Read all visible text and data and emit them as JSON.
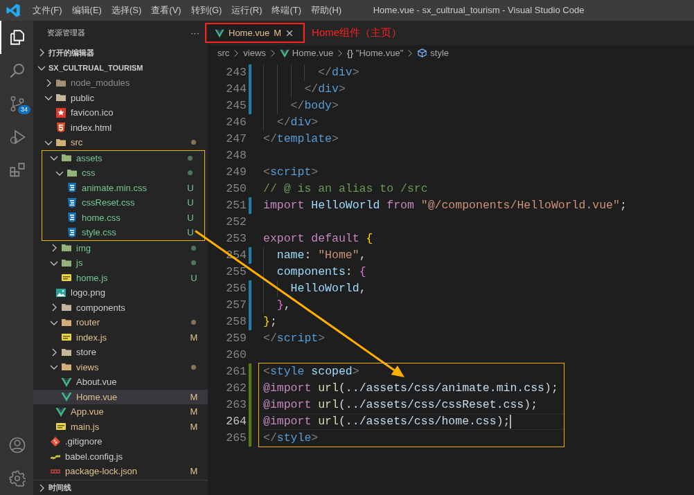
{
  "window": {
    "title": "Home.vue - sx_cultrual_tourism - Visual Studio Code"
  },
  "menu": [
    "文件(F)",
    "编辑(E)",
    "选择(S)",
    "查看(V)",
    "转到(G)",
    "运行(R)",
    "终端(T)",
    "帮助(H)"
  ],
  "activity_bar": [
    {
      "kind": "explorer",
      "selected": true
    },
    {
      "kind": "search",
      "selected": false
    },
    {
      "kind": "source-control",
      "selected": false,
      "badge": "34"
    },
    {
      "kind": "run",
      "selected": false
    },
    {
      "kind": "extensions",
      "selected": false
    }
  ],
  "activity_bar_bottom": [
    {
      "kind": "account",
      "selected": false
    },
    {
      "kind": "settings",
      "selected": false
    }
  ],
  "sidebar": {
    "title": "资源管理器",
    "more": "···",
    "open_editors": {
      "label": "打开的编辑器",
      "expanded": false
    },
    "project": {
      "label": "SX_CULTRUAL_TOURISM",
      "expanded": true
    },
    "tree": [
      {
        "name": "node_modules",
        "kind": "folder",
        "color": "#8c8c8c",
        "expanded": false,
        "selected": false
      },
      {
        "name": "public",
        "kind": "folder",
        "color": "#cccccc",
        "expanded": true,
        "selected": false,
        "children": [
          {
            "name": "favicon.ico",
            "kind": "star",
            "color": "#cccccc",
            "selected": false
          },
          {
            "name": "index.html",
            "kind": "html",
            "color": "#cccccc",
            "selected": false
          }
        ]
      },
      {
        "name": "src",
        "kind": "folder",
        "color": "#e2c08d",
        "expanded": true,
        "dot": true,
        "selected": false,
        "children": [
          {
            "name": "assets",
            "kind": "folder",
            "color": "#73c991",
            "expanded": true,
            "dot": true,
            "framed": true,
            "selected": false,
            "children": [
              {
                "name": "css",
                "kind": "folder",
                "color": "#73c991",
                "expanded": true,
                "dot": true,
                "selected": false,
                "children": [
                  {
                    "name": "animate.min.css",
                    "kind": "css",
                    "color": "#73c991",
                    "badge": "U",
                    "selected": false
                  },
                  {
                    "name": "cssReset.css",
                    "kind": "css",
                    "color": "#73c991",
                    "badge": "U",
                    "selected": false
                  },
                  {
                    "name": "home.css",
                    "kind": "css",
                    "color": "#73c991",
                    "badge": "U",
                    "selected": false
                  },
                  {
                    "name": "style.css",
                    "kind": "css",
                    "color": "#73c991",
                    "badge": "U",
                    "selected": false
                  }
                ]
              }
            ]
          },
          {
            "name": "img",
            "kind": "folder",
            "color": "#73c991",
            "expanded": false,
            "dot": true,
            "selected": false
          },
          {
            "name": "js",
            "kind": "folder",
            "color": "#73c991",
            "expanded": true,
            "dot": true,
            "selected": false,
            "children": [
              {
                "name": "home.js",
                "kind": "js",
                "color": "#73c991",
                "badge": "U",
                "selected": false
              }
            ]
          },
          {
            "name": "logo.png",
            "kind": "image",
            "color": "#cccccc",
            "selected": false
          },
          {
            "name": "components",
            "kind": "folder",
            "color": "#cccccc",
            "expanded": false,
            "selected": false
          },
          {
            "name": "router",
            "kind": "folder",
            "color": "#e2c08d",
            "expanded": true,
            "dot": true,
            "selected": false,
            "children": [
              {
                "name": "index.js",
                "kind": "js",
                "color": "#e2c08d",
                "badge": "M",
                "selected": false
              }
            ]
          },
          {
            "name": "store",
            "kind": "folder",
            "color": "#cccccc",
            "expanded": false,
            "selected": false
          },
          {
            "name": "views",
            "kind": "folder",
            "color": "#e2c08d",
            "expanded": true,
            "dot": true,
            "selected": false,
            "children": [
              {
                "name": "About.vue",
                "kind": "vue",
                "color": "#cccccc",
                "selected": false
              },
              {
                "name": "Home.vue",
                "kind": "vue",
                "color": "#e2c08d",
                "badge": "M",
                "selected": true
              }
            ]
          },
          {
            "name": "App.vue",
            "kind": "vue",
            "color": "#e2c08d",
            "badge": "M",
            "selected": false
          },
          {
            "name": "main.js",
            "kind": "js",
            "color": "#e2c08d",
            "badge": "M",
            "selected": false
          }
        ]
      },
      {
        "name": ".gitignore",
        "kind": "git",
        "color": "#cccccc",
        "selected": false
      },
      {
        "name": "babel.config.js",
        "kind": "babel",
        "color": "#cccccc",
        "selected": false
      },
      {
        "name": "package-lock.json",
        "kind": "json",
        "color": "#e2c08d",
        "badge": "M",
        "selected": false
      }
    ],
    "timeline": {
      "label": "时间线",
      "expanded": false
    }
  },
  "tabs": [
    {
      "title": "Home.vue",
      "kind": "vue",
      "badge": "M",
      "selected": true
    }
  ],
  "breadcrumbs": [
    {
      "text": "src",
      "kind": "folder"
    },
    {
      "text": "views",
      "kind": "folder"
    },
    {
      "text": "Home.vue",
      "kind": "vue"
    },
    {
      "text": "\"Home.vue\"",
      "kind": "object",
      "symbol": "{}"
    },
    {
      "text": "style",
      "kind": "element"
    }
  ],
  "annotations": {
    "tab_frame": {
      "color": "#ff2020"
    },
    "label": {
      "text": "Home组件（主页）",
      "color": "#ff2020"
    },
    "tree_frame": {
      "color": "#f0b400"
    },
    "code_frame": {
      "color": "#f0b400"
    },
    "arrow": {
      "color": "#ffb000"
    }
  },
  "code": [
    {
      "number": "243",
      "color": "#1b81a8",
      "tokens": [
        {
          "kind": "bracket",
          "text": "        </"
        },
        {
          "kind": "tag",
          "text": "div"
        },
        {
          "kind": "bracket",
          "text": ">"
        }
      ]
    },
    {
      "number": "244",
      "color": "#1b81a8",
      "tokens": [
        {
          "kind": "bracket",
          "text": "      </"
        },
        {
          "kind": "tag",
          "text": "div"
        },
        {
          "kind": "bracket",
          "text": ">"
        }
      ]
    },
    {
      "number": "245",
      "color": "#1b81a8",
      "tokens": [
        {
          "kind": "bracket",
          "text": "    </"
        },
        {
          "kind": "tag",
          "text": "body"
        },
        {
          "kind": "bracket",
          "text": ">"
        }
      ]
    },
    {
      "number": "246",
      "tokens": [
        {
          "kind": "bracket",
          "text": "  </"
        },
        {
          "kind": "tag",
          "text": "div"
        },
        {
          "kind": "bracket",
          "text": ">"
        }
      ]
    },
    {
      "number": "247",
      "tokens": [
        {
          "kind": "bracket",
          "text": "</"
        },
        {
          "kind": "tag",
          "text": "template"
        },
        {
          "kind": "bracket",
          "text": ">"
        }
      ]
    },
    {
      "number": "248"
    },
    {
      "number": "249",
      "tokens": [
        {
          "kind": "bracket",
          "text": "<"
        },
        {
          "kind": "tag",
          "text": "script"
        },
        {
          "kind": "bracket",
          "text": ">"
        }
      ]
    },
    {
      "number": "250",
      "tokens": [
        {
          "kind": "comment",
          "text": "// @ is an alias to /src"
        }
      ]
    },
    {
      "number": "251",
      "color": "#1b81a8",
      "tokens": [
        {
          "kind": "keyword",
          "text": "import"
        },
        {
          "kind": "variable",
          "text": " HelloWorld"
        },
        {
          "kind": "keyword",
          "text": " from"
        },
        {
          "kind": "string",
          "text": " \"@/components/HelloWorld.vue\""
        },
        {
          "kind": "plain",
          "text": ";"
        }
      ]
    },
    {
      "number": "252"
    },
    {
      "number": "253",
      "tokens": [
        {
          "kind": "keyword",
          "text": "export"
        },
        {
          "kind": "keyword",
          "text": " default"
        },
        {
          "kind": "gold",
          "text": " {"
        }
      ]
    },
    {
      "number": "254",
      "color": "#1b81a8",
      "tokens": [
        {
          "kind": "variable",
          "text": "  name"
        },
        {
          "kind": "plain",
          "text": ":"
        },
        {
          "kind": "string",
          "text": " \"Home\""
        },
        {
          "kind": "plain",
          "text": ","
        }
      ]
    },
    {
      "number": "255",
      "tokens": [
        {
          "kind": "variable",
          "text": "  components"
        },
        {
          "kind": "plain",
          "text": ":"
        },
        {
          "kind": "pink",
          "text": " {"
        }
      ]
    },
    {
      "number": "256",
      "color": "#1b81a8",
      "tokens": [
        {
          "kind": "variable",
          "text": "    HelloWorld"
        },
        {
          "kind": "plain",
          "text": ","
        }
      ]
    },
    {
      "number": "257",
      "color": "#1b81a8",
      "tokens": [
        {
          "kind": "pink",
          "text": "  }"
        },
        {
          "kind": "plain",
          "text": ","
        }
      ]
    },
    {
      "number": "258",
      "color": "#1b81a8",
      "tokens": [
        {
          "kind": "gold",
          "text": "}"
        },
        {
          "kind": "plain",
          "text": ";"
        }
      ]
    },
    {
      "number": "259",
      "tokens": [
        {
          "kind": "bracket",
          "text": "</"
        },
        {
          "kind": "tag",
          "text": "script"
        },
        {
          "kind": "bracket",
          "text": ">"
        }
      ]
    },
    {
      "number": "260"
    },
    {
      "number": "261",
      "color": "#587c0c",
      "framed": true,
      "tokens": [
        {
          "kind": "bracket",
          "text": "<"
        },
        {
          "kind": "tag",
          "text": "style"
        },
        {
          "kind": "attr",
          "text": " scoped"
        },
        {
          "kind": "bracket",
          "text": ">"
        }
      ]
    },
    {
      "number": "262",
      "color": "#587c0c",
      "framed": true,
      "tokens": [
        {
          "kind": "keyword",
          "text": "@import"
        },
        {
          "kind": "function",
          "text": " url"
        },
        {
          "kind": "plain",
          "text": "("
        },
        {
          "kind": "argument",
          "text": "../assets/css/animate.min.css"
        },
        {
          "kind": "plain",
          "text": ");"
        }
      ]
    },
    {
      "number": "263",
      "color": "#587c0c",
      "framed": true,
      "tokens": [
        {
          "kind": "keyword",
          "text": "@import"
        },
        {
          "kind": "function",
          "text": " url"
        },
        {
          "kind": "plain",
          "text": "("
        },
        {
          "kind": "argument",
          "text": "../assets/css/cssReset.css"
        },
        {
          "kind": "plain",
          "text": ");"
        }
      ]
    },
    {
      "number": "264",
      "color": "#587c0c",
      "framed": true,
      "current": true,
      "tokens": [
        {
          "kind": "keyword",
          "text": "@import"
        },
        {
          "kind": "function",
          "text": " url"
        },
        {
          "kind": "plain",
          "text": "("
        },
        {
          "kind": "argument",
          "text": "../assets/css/home.css"
        },
        {
          "kind": "plain",
          "text": ");"
        }
      ]
    },
    {
      "number": "265",
      "color": "#587c0c",
      "framed": true,
      "tokens": [
        {
          "kind": "bracket",
          "text": "</"
        },
        {
          "kind": "tag",
          "text": "style"
        },
        {
          "kind": "bracket",
          "text": ">"
        }
      ]
    }
  ]
}
